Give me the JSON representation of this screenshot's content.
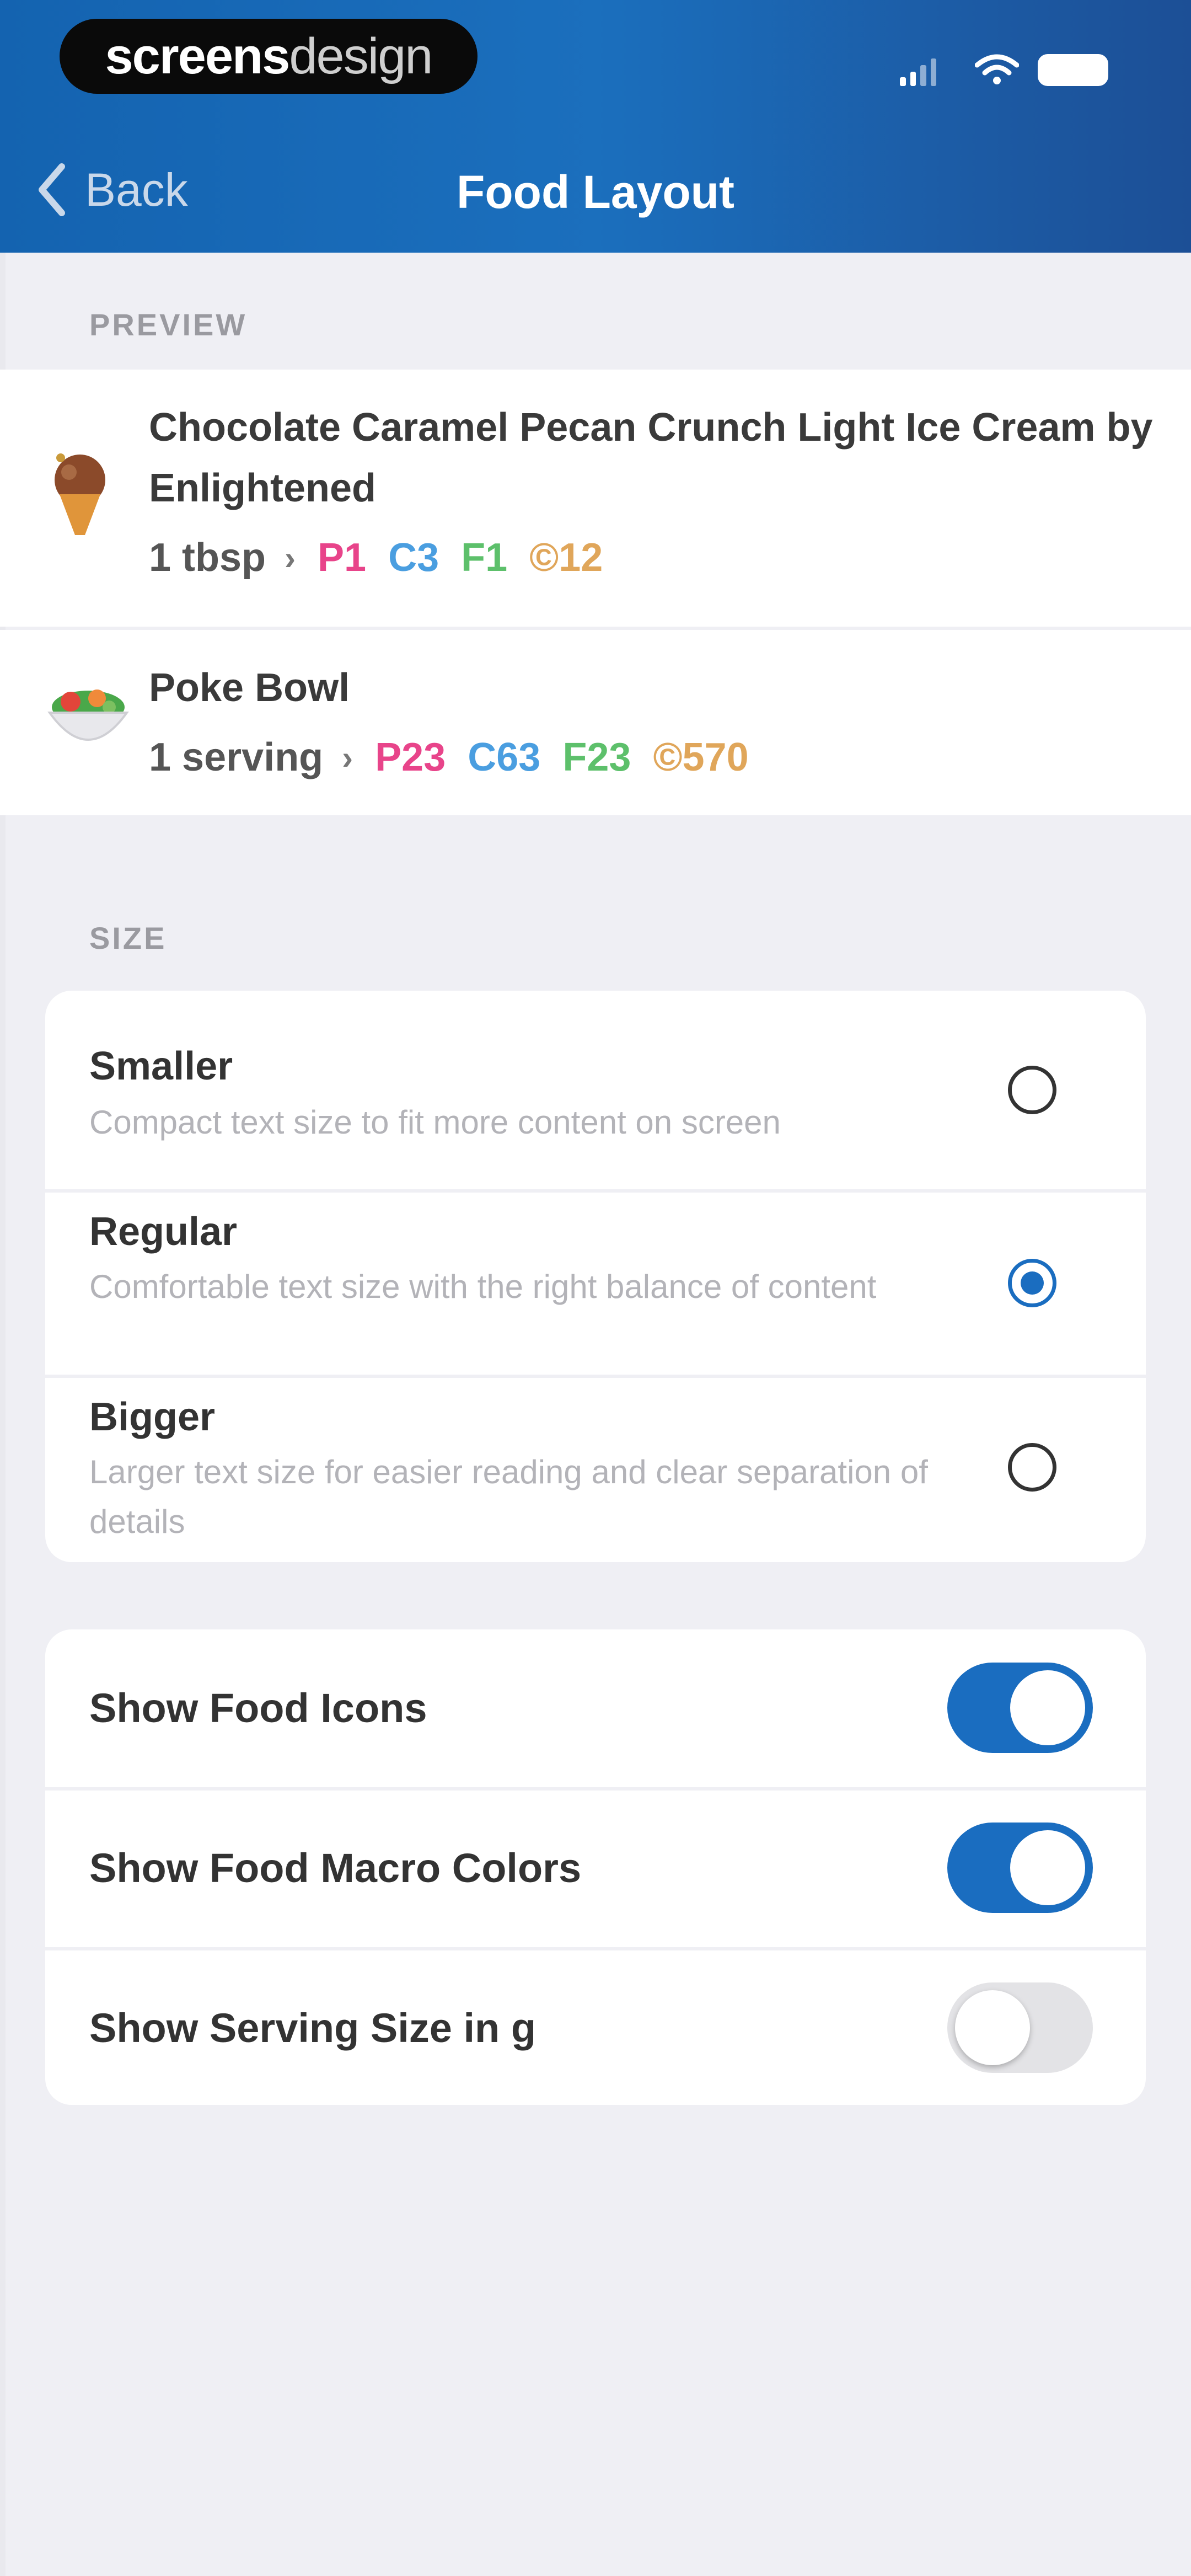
{
  "branding": {
    "logo_part1": "screens",
    "logo_part2": "design"
  },
  "nav": {
    "back_label": "Back",
    "title": "Food Layout"
  },
  "preview": {
    "section_label": "PREVIEW",
    "foods": [
      {
        "name": "Chocolate Caramel Pecan Crunch Light Ice Cream by Enlightened",
        "serving": "1 tbsp",
        "protein": "P1",
        "carbs": "C3",
        "fat": "F1",
        "calories": "©12",
        "icon": "ice-cream-icon"
      },
      {
        "name": "Poke Bowl",
        "serving": "1 serving",
        "protein": "P23",
        "carbs": "C63",
        "fat": "F23",
        "calories": "©570",
        "icon": "salad-bowl-icon"
      }
    ]
  },
  "size": {
    "section_label": "SIZE",
    "options": [
      {
        "title": "Smaller",
        "description": "Compact text size to fit more content on screen",
        "selected": false
      },
      {
        "title": "Regular",
        "description": "Comfortable text size with the right balance of content",
        "selected": true
      },
      {
        "title": "Bigger",
        "description": "Larger text size for easier reading and clear separation of details",
        "selected": false
      }
    ]
  },
  "display_options": [
    {
      "label": "Show Food Icons",
      "enabled": true
    },
    {
      "label": "Show Food Macro Colors",
      "enabled": true
    },
    {
      "label": "Show Serving Size in g",
      "enabled": false
    }
  ],
  "colors": {
    "header_blue": "#1b6fbd",
    "accent": "#1a6dc0",
    "protein": "#e8448a",
    "carbs": "#4a9ee0",
    "fat": "#5dc06b",
    "calories": "#e0a65a"
  }
}
